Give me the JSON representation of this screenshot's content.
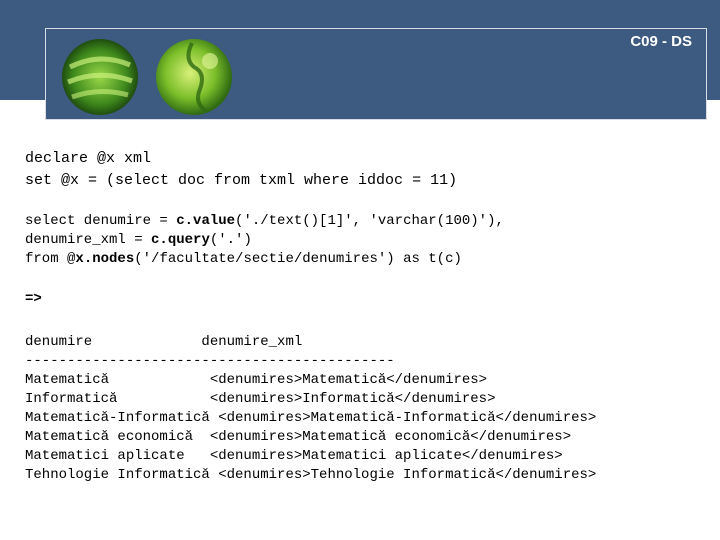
{
  "header": {
    "title": "C09 - DS"
  },
  "query1": {
    "line1": "declare @x xml",
    "line2": "set @x = (select doc from txml where iddoc = 11)"
  },
  "query2": {
    "line1_a": "select denumire = ",
    "line1_b": "c.value",
    "line1_c": "('./text()[1]', 'varchar(100)'),",
    "line2_a": "denumire_xml = ",
    "line2_b": "c.query",
    "line2_c": "('.')",
    "line3_a": "from @",
    "line3_b": "x.nodes",
    "line3_c": "('/facultate/sectie/denumires') as t(c)"
  },
  "arrow": "=>",
  "result": {
    "header": "denumire             denumire_xml",
    "separator": "--------------------------------------------",
    "rows": [
      "Matematică            <denumires>Matematică</denumires>",
      "Informatică           <denumires>Informatică</denumires>",
      "Matematică-Informatică <denumires>Matematică-Informatică</denumires>",
      "Matematică economică  <denumires>Matematică economică</denumires>",
      "Matematici aplicate   <denumires>Matematici aplicate</denumires>",
      "Tehnologie Informatică <denumires>Tehnologie Informatică</denumires>"
    ]
  },
  "colors": {
    "header_bg": "#3d5a80",
    "title_text": "#ffffff"
  }
}
